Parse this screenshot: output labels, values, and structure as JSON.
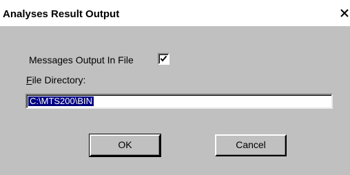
{
  "dialog": {
    "title": "Analyses Result Output",
    "close_icon": "close-icon",
    "messages_label": "Messages Output In File",
    "messages_checked": true,
    "directory_label": "File Directory:",
    "directory_value": "C:\\MTS200\\BIN",
    "ok_label": "OK",
    "cancel_label": "Cancel"
  },
  "colors": {
    "face": "#c0c0c0",
    "title_bg": "#ffffff",
    "selection": "#000080"
  }
}
